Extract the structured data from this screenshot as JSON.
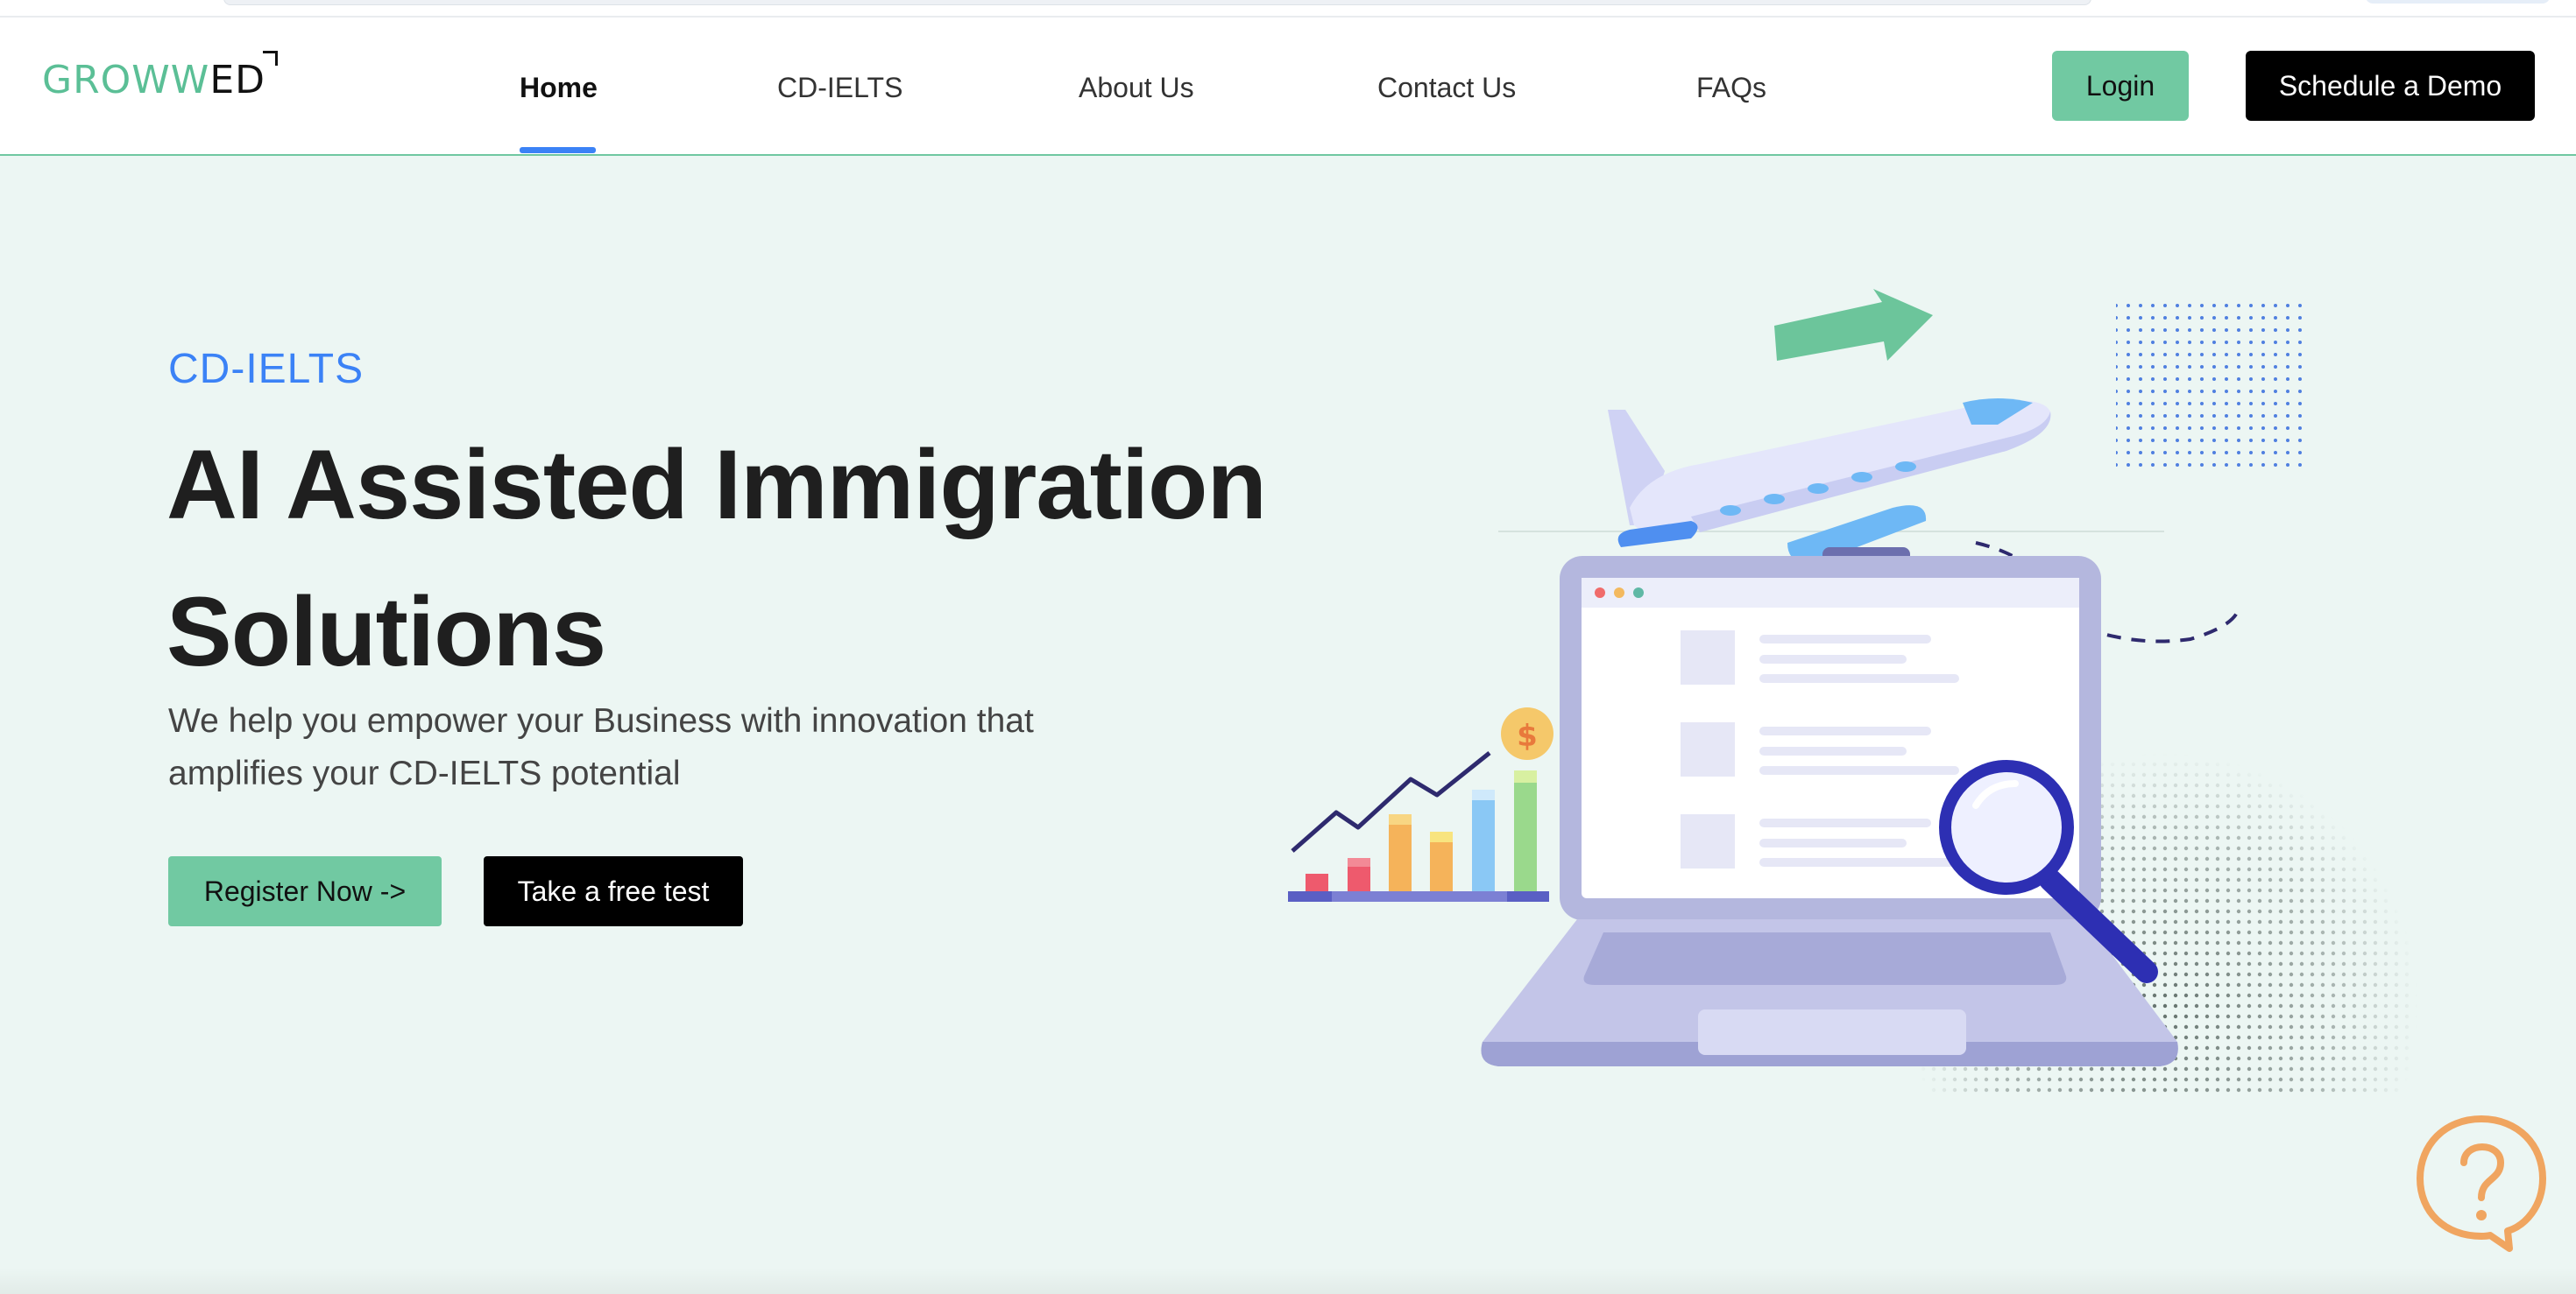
{
  "brand": {
    "logo_part1": "GROWW",
    "logo_part2": "ED",
    "accent_color": "#71c9a2",
    "link_color": "#3b82f6"
  },
  "nav": {
    "items": [
      {
        "label": "Home",
        "active": true
      },
      {
        "label": "CD-IELTS",
        "active": false
      },
      {
        "label": "About Us",
        "active": false
      },
      {
        "label": "Contact Us",
        "active": false
      },
      {
        "label": "FAQs",
        "active": false
      }
    ],
    "login_label": "Login",
    "demo_label": "Schedule a Demo"
  },
  "hero": {
    "eyebrow": "CD-IELTS",
    "headline": "AI Assisted Immigration Solutions",
    "subtitle": "We help you empower your Business with innovation that amplifies your CD-IELTS potential",
    "register_label": "Register Now ->",
    "free_test_label": "Take a free test"
  },
  "help": {
    "icon": "question-bubble-icon",
    "color": "#f0a560"
  }
}
